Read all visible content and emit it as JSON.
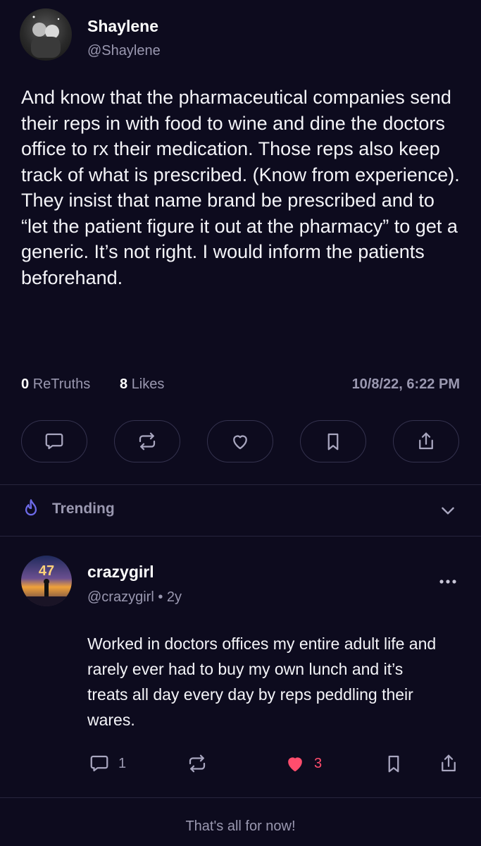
{
  "post": {
    "author_name": "Shaylene",
    "author_handle": "@Shaylene",
    "body": "And know that the pharmaceutical companies send their reps in with food to wine and dine the doctors office to rx their medication. Those reps also keep track of what is prescribed. (Know from experience). They insist that name brand be prescribed and to “let the patient figure it out at the pharmacy” to get a generic. It’s not right. I would inform the patients beforehand.",
    "retruths_count": "0",
    "retruths_label": "ReTruths",
    "likes_count": "8",
    "likes_label": "Likes",
    "timestamp": "10/8/22, 6:22 PM",
    "actions": [
      "reply-icon",
      "retruth-icon",
      "heart-icon",
      "bookmark-icon",
      "share-icon"
    ]
  },
  "trending": {
    "label": "Trending",
    "icon": "flame-icon"
  },
  "reply": {
    "author_name": "crazygirl",
    "author_handle": "@crazygirl",
    "separator": "•",
    "age": "2y",
    "avatar_text": "47",
    "body": "Worked in doctors offices my entire adult life and rarely ever had to buy my own lunch and it’s treats all day every day by reps peddling their wares.",
    "reply_count": "1",
    "like_count": "3",
    "liked": true
  },
  "footer": {
    "text": "That's all for now!"
  },
  "colors": {
    "background": "#0d0b1e",
    "muted": "#9a98b0",
    "accent": "#6d6ae8",
    "like": "#ff4d6d",
    "border": "#34324e"
  }
}
